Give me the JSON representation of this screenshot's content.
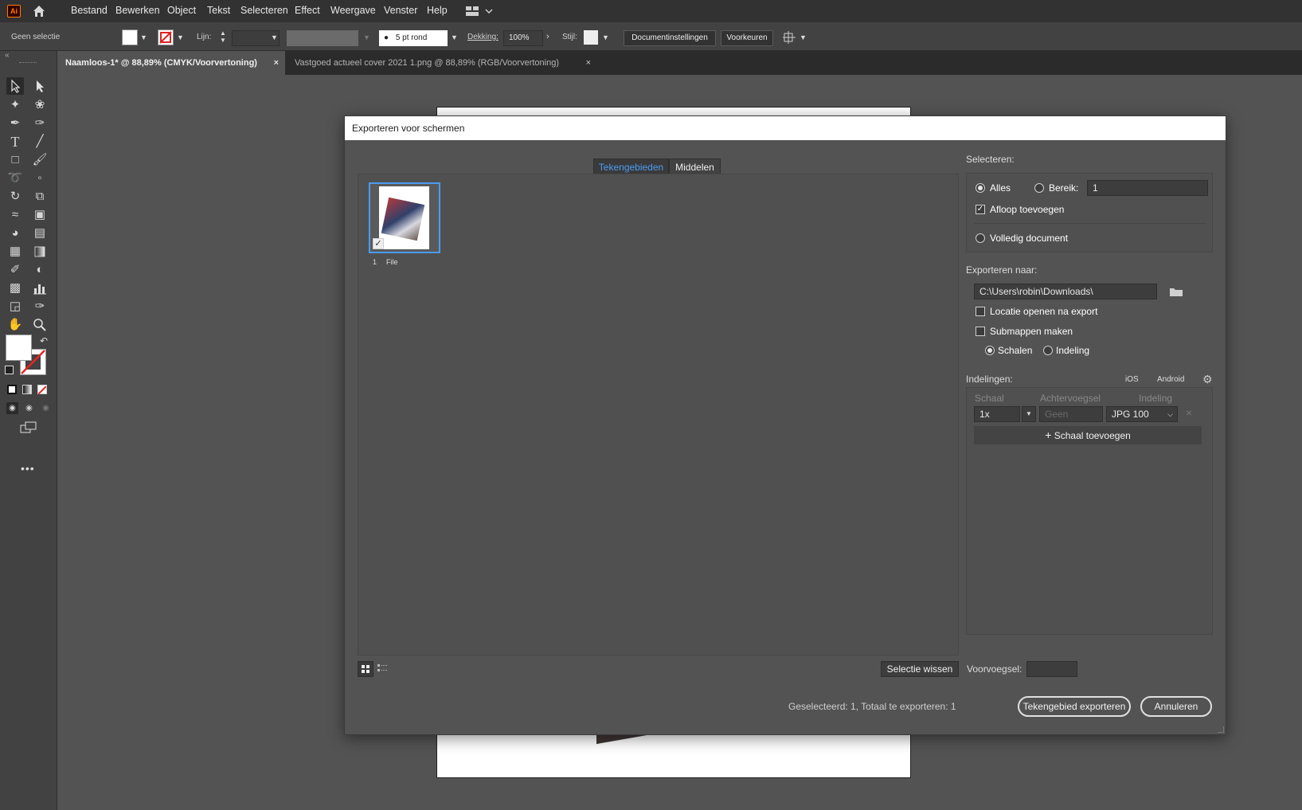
{
  "app": {
    "logo": "Ai"
  },
  "menu": [
    "Bestand",
    "Bewerken",
    "Object",
    "Tekst",
    "Selecteren",
    "Effect",
    "Weergave",
    "Venster",
    "Help"
  ],
  "control": {
    "selection": "Geen selectie",
    "stroke_label": "Lijn:",
    "brush": "5 pt rond",
    "opacity_label": "Dekking:",
    "opacity": "100%",
    "style_label": "Stijl:",
    "doc_settings": "Documentinstellingen",
    "preferences": "Voorkeuren"
  },
  "tabs": [
    {
      "label": "Naamloos-1* @ 88,89% (CMYK/Voorvertoning)",
      "active": true
    },
    {
      "label": "Vastgoed actueel cover 2021 1.png @ 88,89% (RGB/Voorvertoning)",
      "active": false
    }
  ],
  "dialog": {
    "title": "Exporteren voor schermen",
    "tab_artboards": "Tekengebieden",
    "tab_assets": "Middelen",
    "artboard": {
      "number": "1",
      "name": "File"
    },
    "clear_selection": "Selectie wissen",
    "prefix_label": "Voorvoegsel:",
    "status": "Geselecteerd: 1, Totaal te exporteren: 1",
    "export_btn": "Tekengebied exporteren",
    "cancel_btn": "Annuleren",
    "select": {
      "header": "Selecteren:",
      "all": "Alles",
      "range": "Bereik:",
      "range_value": "1",
      "bleed": "Afloop toevoegen",
      "full_doc": "Volledig document"
    },
    "export_to": {
      "header": "Exporteren naar:",
      "path": "C:\\Users\\robin\\Downloads\\",
      "open_location": "Locatie openen na export",
      "subfolders": "Submappen maken",
      "scale": "Schalen",
      "format": "Indeling"
    },
    "formats": {
      "header": "Indelingen:",
      "ios": "iOS",
      "android": "Android",
      "col_scale": "Schaal",
      "col_suffix": "Achtervoegsel",
      "col_format": "Indeling",
      "scale_value": "1x",
      "suffix_placeholder": "Geen",
      "format_value": "JPG 100",
      "add_scale": "Schaal toevoegen"
    }
  },
  "colors": {
    "accent": "#4b9cf2",
    "panel": "#535353",
    "dark": "#323232"
  }
}
